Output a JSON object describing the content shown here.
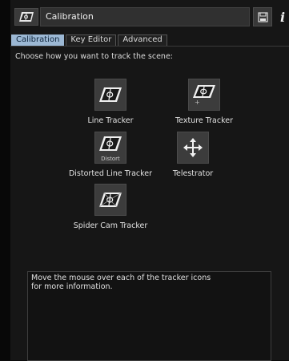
{
  "header": {
    "title": "Calibration",
    "save_icon": "save-icon",
    "info_label": "i"
  },
  "tabs": [
    {
      "label": "Calibration",
      "active": true
    },
    {
      "label": "Key Editor",
      "active": false
    },
    {
      "label": "Advanced",
      "active": false
    }
  ],
  "instruction": "Choose how you want to track the scene:",
  "trackers": [
    {
      "label": "Line Tracker",
      "icon": "line-tracker-icon"
    },
    {
      "label": "Texture Tracker",
      "icon": "texture-tracker-icon"
    },
    {
      "label": "Distorted Line Tracker",
      "icon": "distorted-line-tracker-icon",
      "icon_text": "Distort"
    },
    {
      "label": "Telestrator",
      "icon": "telestrator-icon"
    },
    {
      "label": "Spider Cam Tracker",
      "icon": "spider-cam-tracker-icon"
    }
  ],
  "info": {
    "line1": "Move the mouse over each of the tracker icons",
    "line2": " for more information."
  },
  "colors": {
    "accent": "#9cb8d4",
    "background": "#161616",
    "panel": "#3c3c3c"
  }
}
